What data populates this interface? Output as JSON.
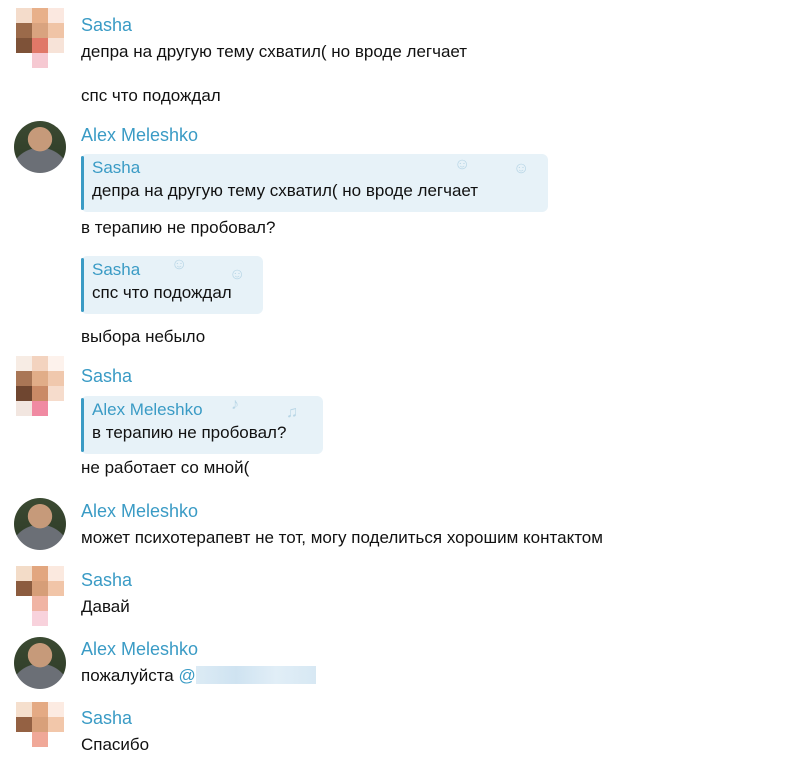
{
  "users": {
    "sasha": "Sasha",
    "alex": "Alex Meleshko"
  },
  "colors": {
    "name": "#3a9bc5",
    "quote_bg": "#e7f2f8"
  },
  "messages": {
    "m1_line1": "депра на другую тему схватил( но вроде легчает",
    "m1_line2": "спс что подождал",
    "m2_quote1_name": "Sasha",
    "m2_quote1_text": "депра на другую тему схватил( но вроде легчает",
    "m2_reply1": "в терапию не пробовал?",
    "m2_quote2_name": "Sasha",
    "m2_quote2_text": "спс что подождал",
    "m2_reply2": "выбора небыло",
    "m3_quote_name": "Alex Meleshko",
    "m3_quote_text": "в терапию не пробовал?",
    "m3_text": "не работает со мной(",
    "m4_text": "может психотерапевт не тот, могу поделиться хорошим контактом",
    "m5_text": "Давай",
    "m6_text": "пожалуйста",
    "m6_mention": "@",
    "m7_text": "Спасибо"
  }
}
